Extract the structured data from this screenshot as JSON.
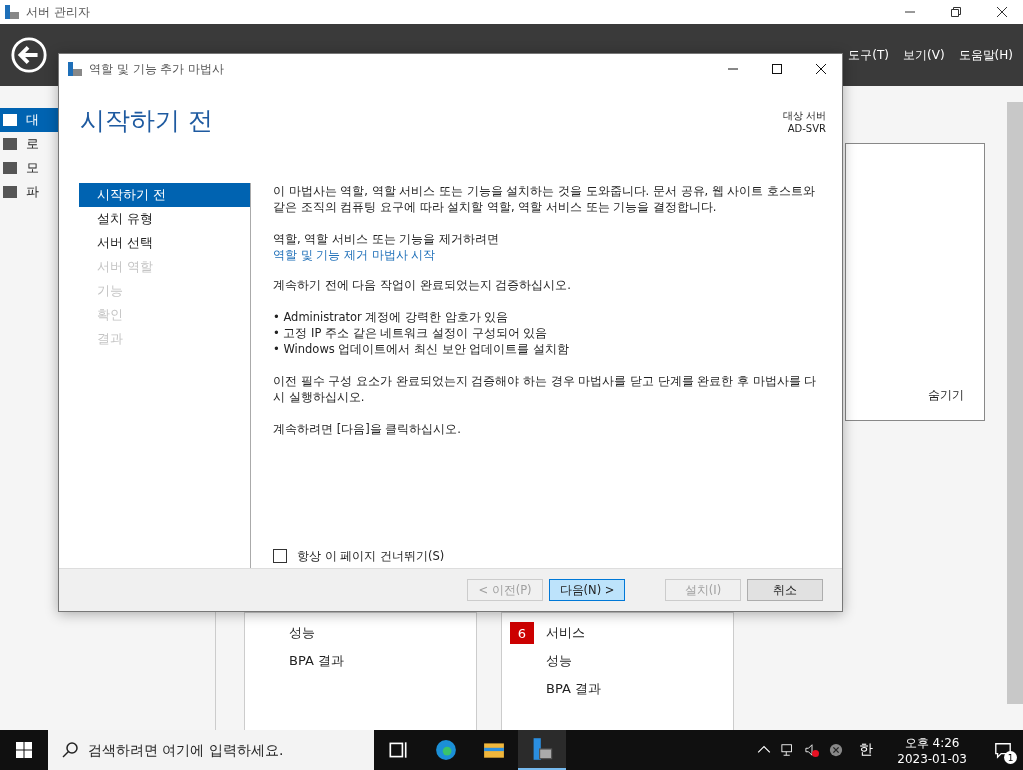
{
  "app_window": {
    "title": "서버 관리자",
    "menus": [
      {
        "label": "도구(T)"
      },
      {
        "label": "보기(V)"
      },
      {
        "label": "도움말(H)"
      }
    ],
    "sidebar": [
      {
        "label": "대",
        "selected": true
      },
      {
        "label": "로",
        "selected": false
      },
      {
        "label": "모",
        "selected": false
      },
      {
        "label": "파",
        "selected": false
      }
    ],
    "hide_link": "숨기기",
    "tiles": [
      {
        "rows": [
          {
            "label": "성능"
          },
          {
            "label": "BPA 결과"
          }
        ]
      },
      {
        "rows": [
          {
            "label": "서비스",
            "count": "6"
          },
          {
            "label": "성능"
          },
          {
            "label": "BPA 결과"
          }
        ]
      }
    ]
  },
  "dialog": {
    "title": "역할 및 기능 추가 마법사",
    "heading": "시작하기 전",
    "target_label": "대상 서버",
    "target_value": "AD-SVR",
    "steps": [
      {
        "label": "시작하기 전",
        "selected": true,
        "disabled": false
      },
      {
        "label": "설치 유형",
        "selected": false,
        "disabled": false
      },
      {
        "label": "서버 선택",
        "selected": false,
        "disabled": false
      },
      {
        "label": "서버 역할",
        "selected": false,
        "disabled": true
      },
      {
        "label": "기능",
        "selected": false,
        "disabled": true
      },
      {
        "label": "확인",
        "selected": false,
        "disabled": true
      },
      {
        "label": "결과",
        "selected": false,
        "disabled": true
      }
    ],
    "intro": "이 마법사는 역할, 역할 서비스 또는 기능을 설치하는 것을 도와줍니다. 문서 공유, 웹 사이트 호스트와 같은 조직의 컴퓨팅 요구에 따라 설치할 역할, 역할 서비스 또는 기능을 결정합니다.",
    "remove_text": "역할, 역할 서비스 또는 기능을 제거하려면",
    "remove_link": "역할 및 기능 제거 마법사 시작",
    "verify_text": "계속하기 전에 다음 작업이 완료되었는지 검증하십시오.",
    "bullets": [
      "• Administrator 계정에 강력한 암호가 있음",
      "• 고정 IP 주소 같은 네트워크 설정이 구성되어 있음",
      "• Windows 업데이트에서 최신 보안 업데이트를 설치함"
    ],
    "retry_text": "이전 필수 구성 요소가 완료되었는지 검증해야 하는 경우 마법사를 닫고 단계를 완료한 후 마법사를 다시 실행하십시오.",
    "continue_text": "계속하려면 [다음]을 클릭하십시오.",
    "skip_checkbox": {
      "label": "항상 이 페이지 건너뛰기(S)",
      "checked": false
    },
    "buttons": [
      {
        "label": "< 이전(P)",
        "disabled": true,
        "selected": false
      },
      {
        "label": "다음(N) >",
        "disabled": false,
        "selected": true
      },
      {
        "label": "설치(I)",
        "disabled": true,
        "selected": false
      },
      {
        "label": "취소",
        "disabled": false,
        "selected": false
      }
    ]
  },
  "taskbar": {
    "search_placeholder": "검색하려면 여기에 입력하세요.",
    "ime": "한",
    "time": "오후 4:26",
    "date": "2023-01-03",
    "notification_count": "1"
  }
}
